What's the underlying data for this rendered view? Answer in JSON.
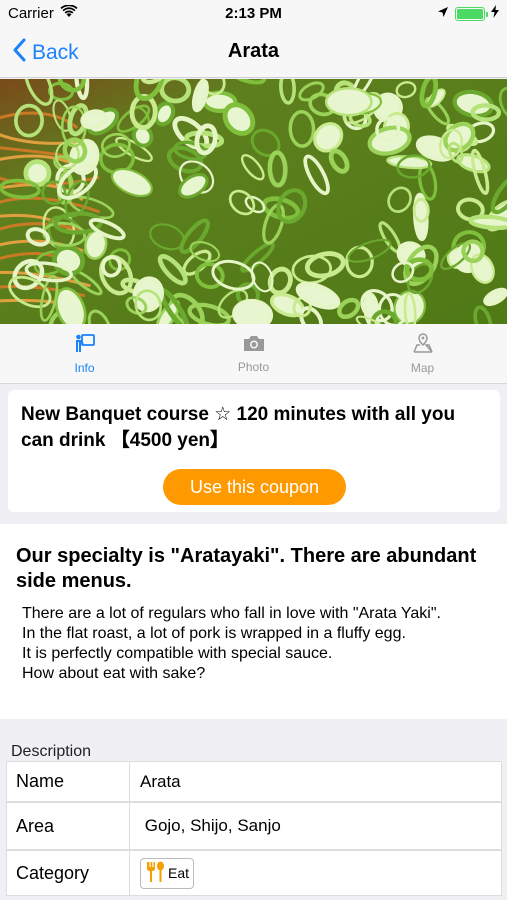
{
  "status_bar": {
    "carrier": "Carrier",
    "time": "2:13 PM",
    "battery_level": 1.0,
    "accent": "#4cd964"
  },
  "nav": {
    "back_label": "Back",
    "title": "Arata",
    "accent": "#1a82fb"
  },
  "tabs": [
    {
      "label": "Info",
      "icon": "info-board-icon",
      "active": true
    },
    {
      "label": "Photo",
      "icon": "camera-icon",
      "active": false
    },
    {
      "label": "Map",
      "icon": "map-icon",
      "active": false
    }
  ],
  "coupon": {
    "title": "New Banquet course ☆ 120 minutes with all you can drink 【4500 yen】",
    "button_label": "Use this coupon",
    "button_color": "#ff9900"
  },
  "specialty": {
    "title": "Our specialty is \"Aratayaki\". There are abundant side menus.",
    "body": "There are a lot of regulars who fall in love with \"Arata Yaki\".\nIn the flat roast, a lot of pork is wrapped in a fluffy egg.\nIt is perfectly compatible with special sauce.\nHow about eat with sake?"
  },
  "description": {
    "header": "Description",
    "rows": [
      {
        "label": "Name",
        "value": "Arata"
      },
      {
        "label": "Area",
        "value": " Gojo, Shijo, Sanjo"
      },
      {
        "label": "Category",
        "value": "Eat",
        "icon": "fork-spoon-icon"
      }
    ]
  }
}
